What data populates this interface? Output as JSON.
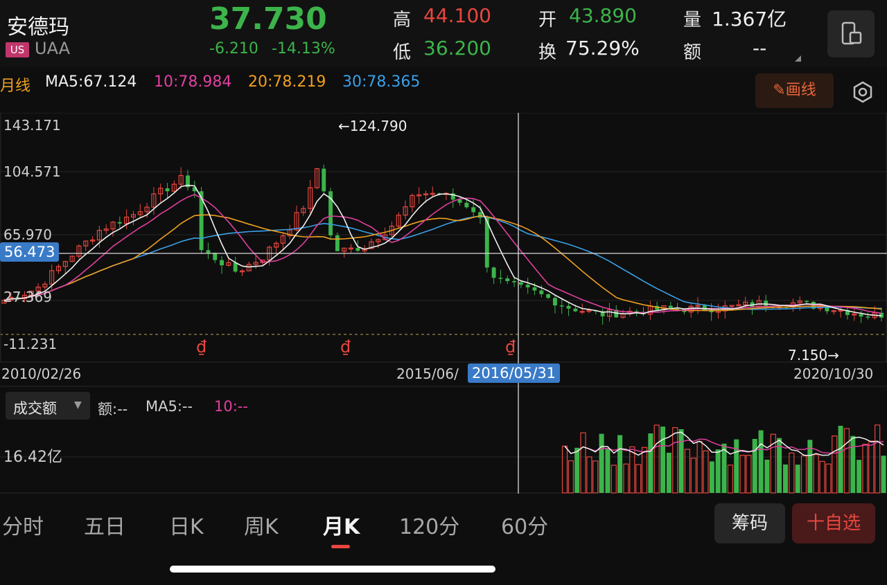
{
  "header": {
    "name": "安德玛",
    "market": "US",
    "ticker": "UAA",
    "price": "37.730",
    "change": "-6.210",
    "change_pct": "-14.13%",
    "stats": [
      {
        "label": "高",
        "value": "44.100",
        "color": "#e8473f"
      },
      {
        "label": "低",
        "value": "36.200",
        "color": "#3cb44b"
      },
      {
        "label": "开",
        "value": "43.890",
        "color": "#3cb44b"
      },
      {
        "label": "换",
        "value": "75.29%",
        "color": "#f0f0f0"
      },
      {
        "label": "量",
        "value": "1.367亿",
        "color": "#f0f0f0"
      },
      {
        "label": "额",
        "value": "--",
        "color": "#f0f0f0"
      }
    ]
  },
  "ma_row": {
    "period": "月线",
    "ma5": "MA5:67.124",
    "ma10": "10:78.984",
    "ma20": "20:78.219",
    "ma30": "30:78.365",
    "draw_label": "画线",
    "colors": {
      "period": "#f0a020",
      "ma5": "#f0f0f0",
      "ma10": "#e040a0",
      "ma20": "#f0a020",
      "ma30": "#3aa0e8"
    }
  },
  "chart": {
    "y_labels": [
      "143.171",
      "104.571",
      "65.970",
      "27.369",
      "-11.231"
    ],
    "crosshair_value": "56.473",
    "high_marker": "←124.790",
    "low_marker": "7.150→",
    "date_start": "2010/02/26",
    "date_mid": "2015/06/",
    "date_cross": "2016/05/31",
    "date_end": "2020/10/30",
    "event_marker": "₫"
  },
  "volume": {
    "selector": "成交额",
    "amt": "额:--",
    "ma5": "MA5:--",
    "ma10": "10:--",
    "y_label": "16.42亿"
  },
  "tabs": [
    "分时",
    "五日",
    "日K",
    "周K",
    "月K",
    "120分",
    "60分"
  ],
  "active_tab": "月K",
  "buttons": {
    "chips": "筹码",
    "watch": "自选",
    "watch_prefix": "十"
  },
  "colors": {
    "up": "#e8473f",
    "down": "#3cb44b",
    "accent": "#3a7bc8"
  }
}
